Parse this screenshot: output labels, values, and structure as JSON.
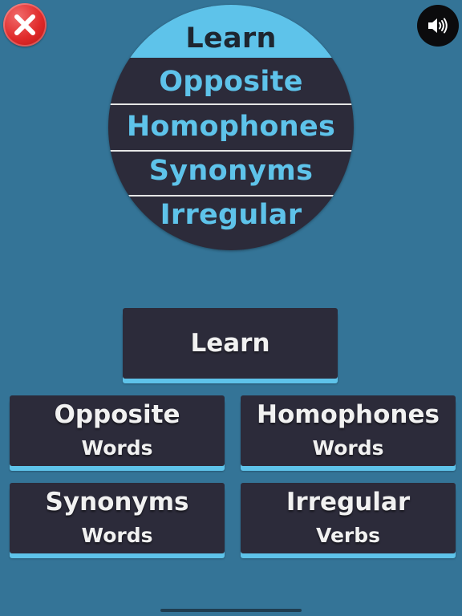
{
  "header": {
    "close_icon": "close-icon",
    "sound_icon": "speaker-volume-icon"
  },
  "circle_menu": {
    "items": [
      {
        "label": "Learn",
        "active": true
      },
      {
        "label": "Opposite",
        "active": false
      },
      {
        "label": "Homophones",
        "active": false
      },
      {
        "label": "Synonyms",
        "active": false
      },
      {
        "label": "Irregular",
        "active": false
      }
    ],
    "colors": {
      "background": "#2c2b3a",
      "accent": "#5ec3ea"
    }
  },
  "buttons": {
    "learn": {
      "title": "Learn"
    },
    "opposite": {
      "title": "Opposite",
      "subtitle": "Words"
    },
    "homophones": {
      "title": "Homophones",
      "subtitle": "Words"
    },
    "synonyms": {
      "title": "Synonyms",
      "subtitle": "Words"
    },
    "irregular": {
      "title": "Irregular",
      "subtitle": "Verbs"
    }
  },
  "colors": {
    "page_background": "#347497",
    "button_background": "#2c2b3a",
    "button_accent": "#5ec3ea",
    "close_red": "#e02a2a"
  }
}
